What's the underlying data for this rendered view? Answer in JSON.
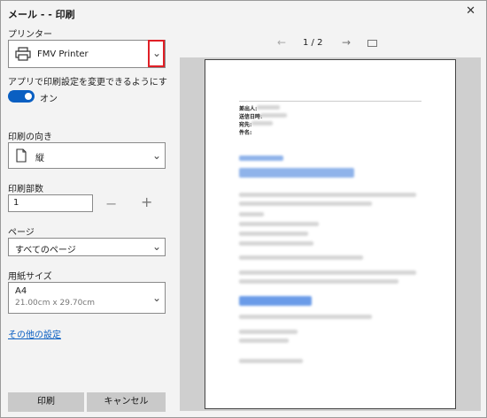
{
  "title": "メール - - 印刷",
  "printer": {
    "label": "プリンター",
    "name": "FMV Printer"
  },
  "app_settings": {
    "label": "アプリで印刷設定を変更できるようにする",
    "toggle_state": "オン",
    "toggle_on": true
  },
  "orientation": {
    "label": "印刷の向き",
    "value": "縦"
  },
  "copies": {
    "label": "印刷部数",
    "value": "1",
    "minus": "−",
    "plus": "+"
  },
  "pages": {
    "label": "ページ",
    "value": "すべてのページ"
  },
  "paper": {
    "label": "用紙サイズ",
    "name": "A4",
    "dimensions": "21.00cm x 29.70cm"
  },
  "more_settings": "その他の設定",
  "buttons": {
    "print": "印刷",
    "cancel": "キャンセル"
  },
  "preview": {
    "current_page": "1",
    "total_pages": "2",
    "page_indicator": "1 / 2",
    "header_labels": [
      "差出人:",
      "送信日時:",
      "宛先:",
      "件名:"
    ]
  },
  "icons": {
    "close": "close-icon",
    "printer": "printer-icon",
    "chevron": "chevron-down-icon",
    "prev": "arrow-left-icon",
    "next": "arrow-right-icon",
    "fit": "fit-page-icon",
    "document": "document-portrait-icon"
  },
  "colors": {
    "accent": "#0a5fc2",
    "highlight": "#e01f26",
    "button_bg": "#c9c9c9",
    "preview_bg": "#cfcfcf"
  }
}
